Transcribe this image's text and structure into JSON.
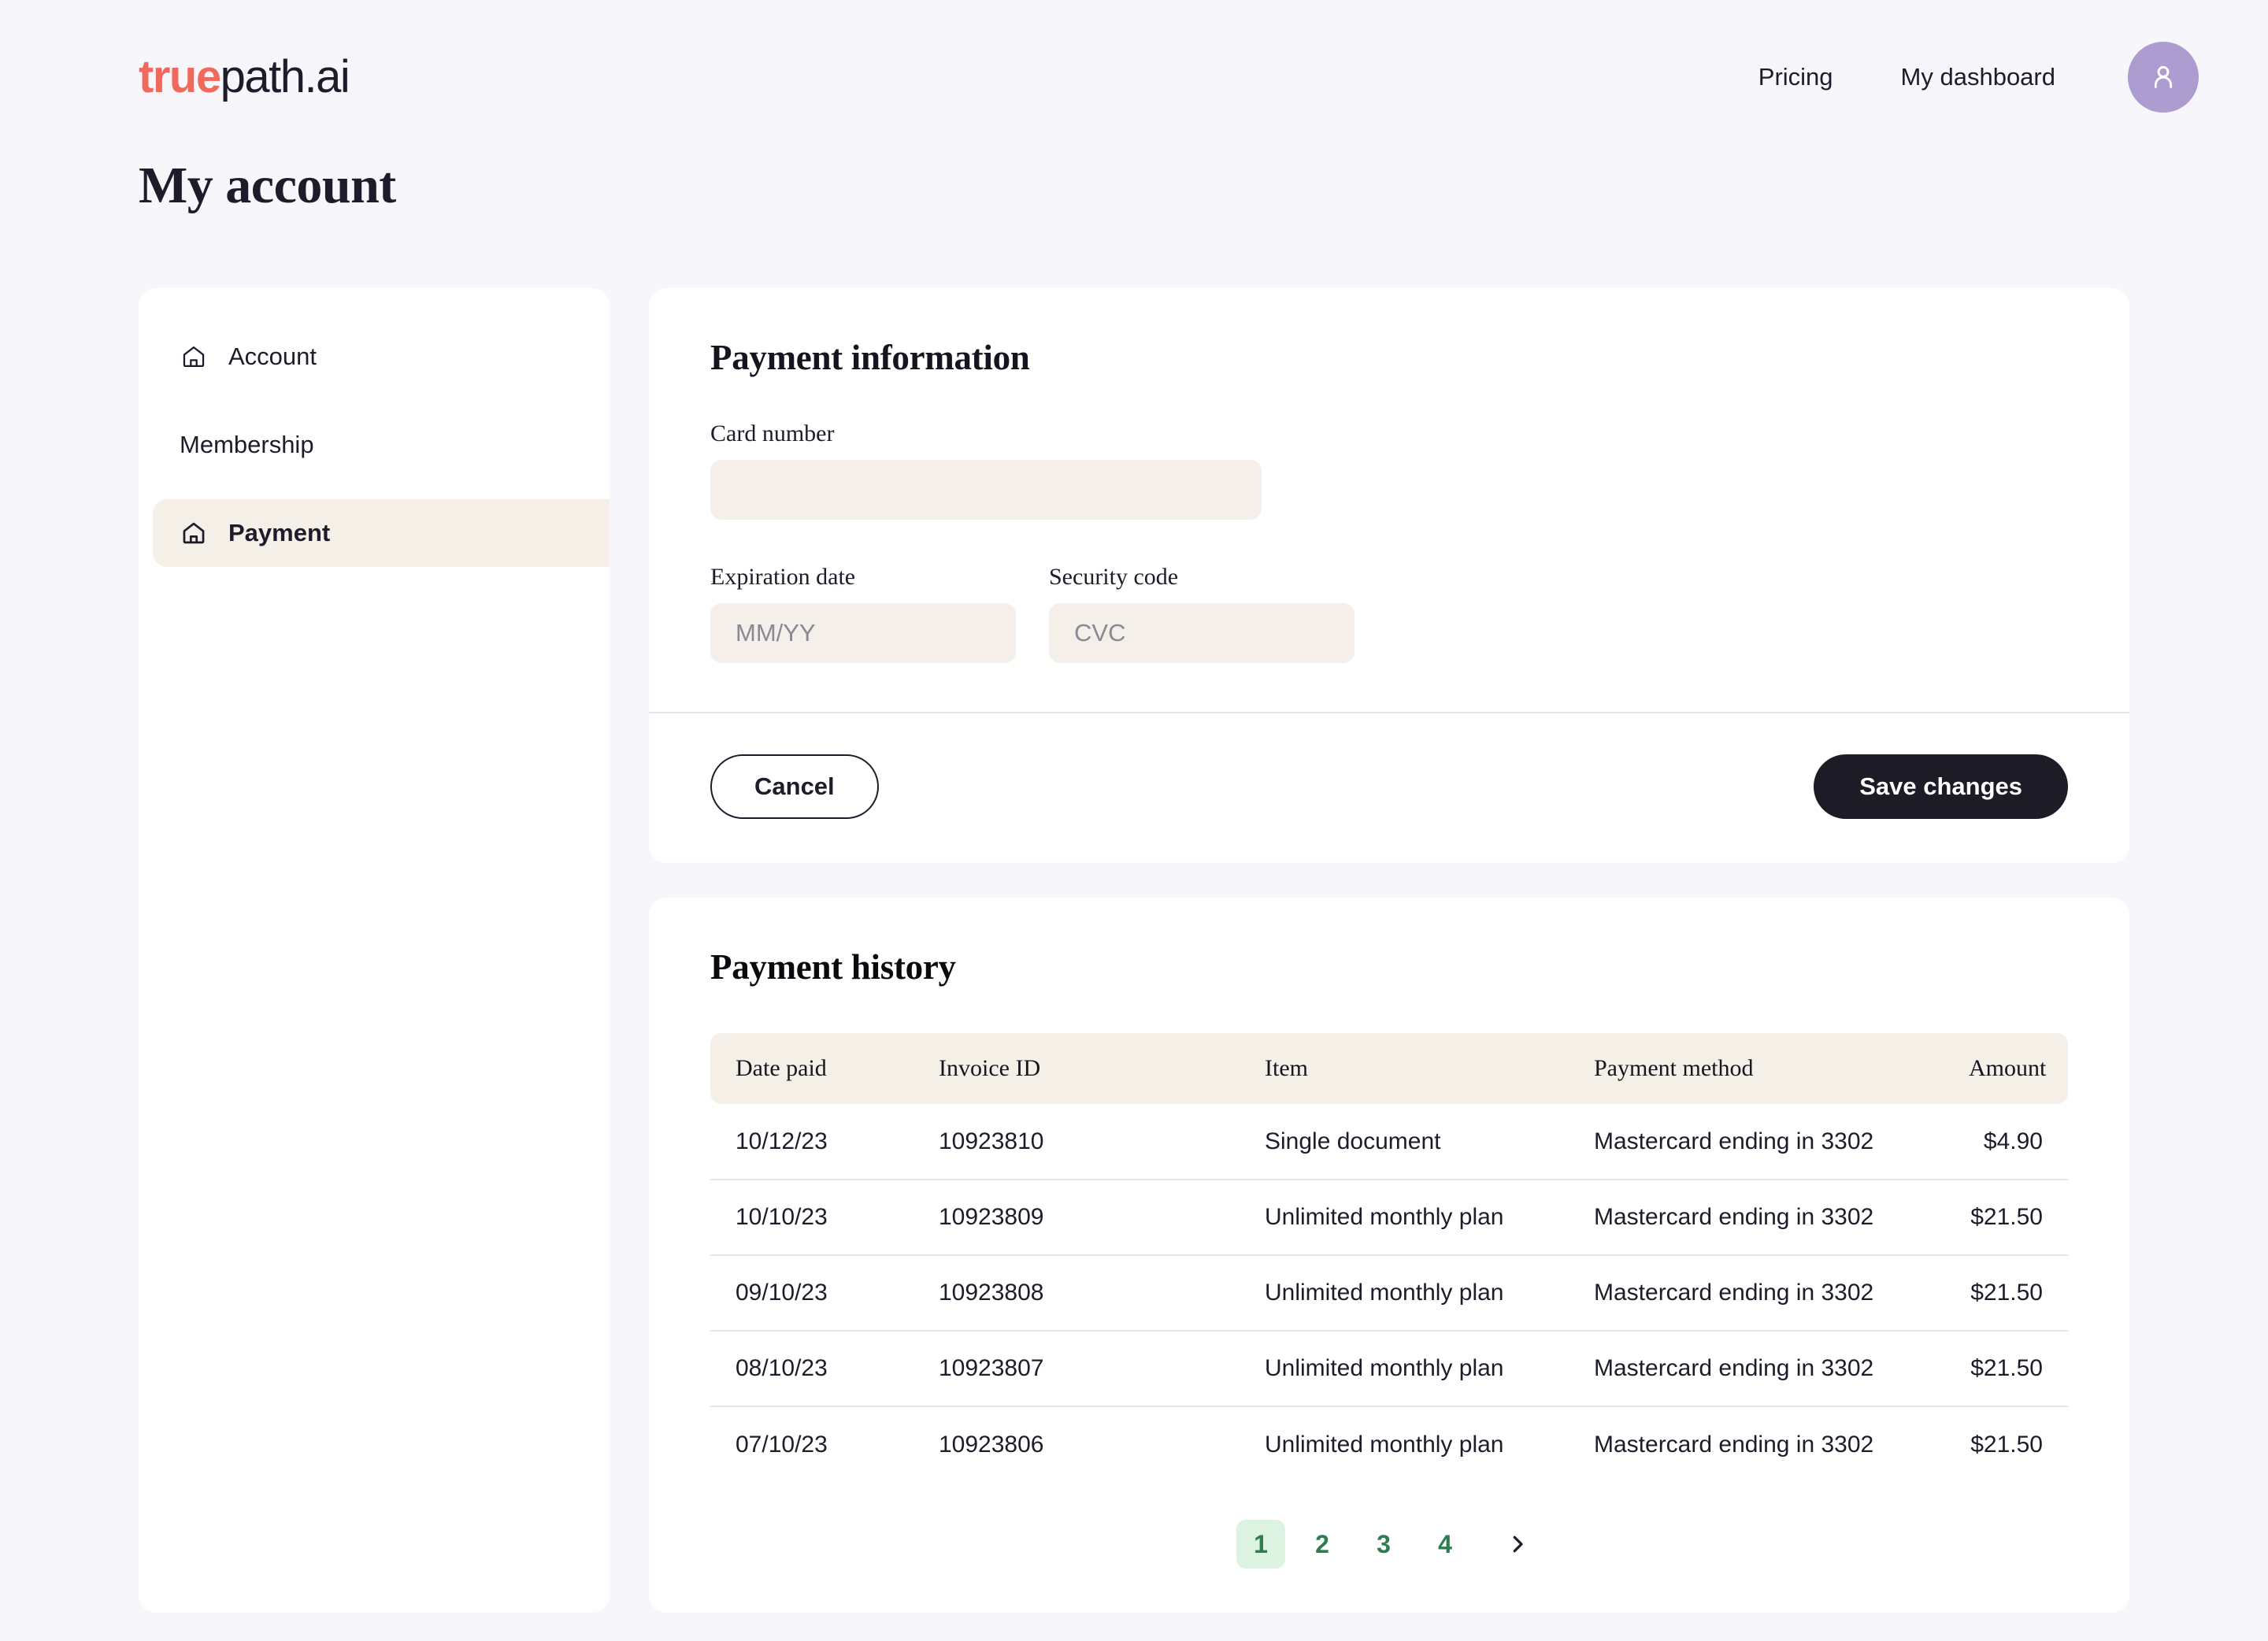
{
  "brand": {
    "logo_accent": "true",
    "logo_rest": "path.ai",
    "accent_color": "#f1685c",
    "dark_color": "#1e1c2a"
  },
  "nav": {
    "pricing": "Pricing",
    "dashboard": "My dashboard",
    "avatar_color": "#ad9cd0"
  },
  "page": {
    "title": "My account"
  },
  "sidebar": {
    "items": [
      {
        "label": "Account",
        "icon": "home-icon",
        "active": false,
        "has_icon": true
      },
      {
        "label": "Membership",
        "icon": "",
        "active": false,
        "has_icon": false
      },
      {
        "label": "Payment",
        "icon": "home-icon",
        "active": true,
        "has_icon": true
      }
    ]
  },
  "payment_form": {
    "title": "Payment information",
    "card_number_label": "Card number",
    "card_number_value": "",
    "card_number_placeholder": "",
    "expiration_label": "Expiration date",
    "expiration_value": "",
    "expiration_placeholder": "MM/YY",
    "security_label": "Security code",
    "security_value": "",
    "security_placeholder": "CVC",
    "cancel_label": "Cancel",
    "save_label": "Save changes"
  },
  "history": {
    "title": "Payment history",
    "columns": [
      "Date paid",
      "Invoice ID",
      "Item",
      "Payment method",
      "Amount"
    ],
    "rows": [
      {
        "date": "10/12/23",
        "invoice": "10923810",
        "item": "Single document",
        "method": "Mastercard ending in 3302",
        "amount": "$4.90"
      },
      {
        "date": "10/10/23",
        "invoice": "10923809",
        "item": "Unlimited monthly plan",
        "method": "Mastercard ending in 3302",
        "amount": "$21.50"
      },
      {
        "date": "09/10/23",
        "invoice": "10923808",
        "item": "Unlimited monthly plan",
        "method": "Mastercard ending in 3302",
        "amount": "$21.50"
      },
      {
        "date": "08/10/23",
        "invoice": "10923807",
        "item": "Unlimited monthly plan",
        "method": "Mastercard ending in 3302",
        "amount": "$21.50"
      },
      {
        "date": "07/10/23",
        "invoice": "10923806",
        "item": "Unlimited monthly plan",
        "method": "Mastercard ending in 3302",
        "amount": "$21.50"
      }
    ],
    "pagination": {
      "pages": [
        "1",
        "2",
        "3",
        "4"
      ],
      "current": "1",
      "next_icon": "chevron-right-icon",
      "active_bg": "#ddf3e2",
      "link_color": "#2f7d4e"
    }
  }
}
